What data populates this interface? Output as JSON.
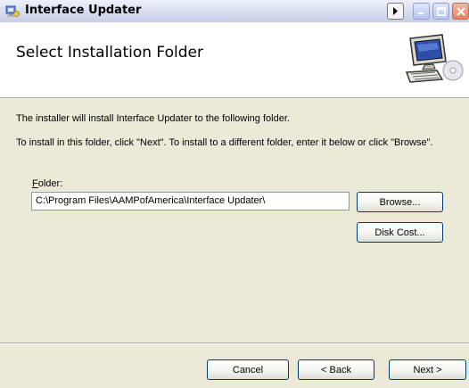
{
  "window": {
    "title": "Interface Updater"
  },
  "banner": {
    "heading": "Select Installation Folder"
  },
  "body": {
    "intro": "The installer will install Interface Updater to the following folder.",
    "instructions": "To install in this folder, click \"Next\". To install to a different folder, enter it below or click \"Browse\"."
  },
  "folder": {
    "label_accel": "F",
    "label_rest": "older:",
    "value": "C:\\Program Files\\AAMPofAmerica\\Interface Updater\\"
  },
  "buttons": {
    "browse": "Browse...",
    "disk_cost": "Disk Cost...",
    "cancel": "Cancel",
    "back": "< Back",
    "next": "Next >"
  },
  "icons": {
    "title": "installer-icon",
    "banner": "computer-cd-icon",
    "titlebar_arrow": "right-arrow-icon",
    "minimize": "minimize-icon",
    "maximize": "maximize-icon",
    "close": "close-icon"
  }
}
